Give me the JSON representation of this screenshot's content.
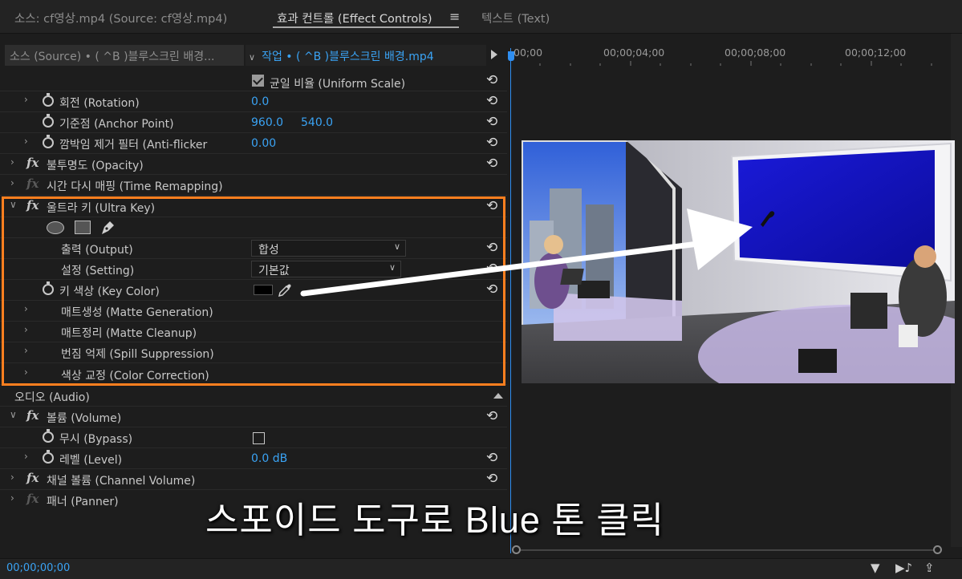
{
  "tabs": [
    {
      "label": "소스: cf영상.mp4 (Source: cf영상.mp4)"
    },
    {
      "label": "효과 컨트롤 (Effect Controls)"
    },
    {
      "label": "텍스트 (Text)"
    }
  ],
  "header": {
    "source_clip": "소스 (Source) • ( ^B )블루스크린 배경...",
    "sequence_clip": "작업 • ( ^B )블루스크린 배경.mp4",
    "ruler": [
      "00;00",
      "00;00;04;00",
      "00;00;08;00",
      "00;00;12;00"
    ]
  },
  "rows": {
    "uniform_scale": "균일 비율 (Uniform Scale)",
    "rotation": {
      "label": "회전 (Rotation)",
      "value": "0.0"
    },
    "anchor": {
      "label": "기준점 (Anchor Point)",
      "x": "960.0",
      "y": "540.0"
    },
    "antiflicker": {
      "label": "깜박임 제거 필터 (Anti-flicker",
      "value": "0.00"
    },
    "opacity": "불투명도 (Opacity)",
    "time_remap": "시간 다시 매핑 (Time Remapping)",
    "ultra_key": "울트라 키 (Ultra Key)",
    "output": {
      "label": "출력 (Output)",
      "value": "합성"
    },
    "setting": {
      "label": "설정 (Setting)",
      "value": "기본값"
    },
    "key_color": {
      "label": "키 색상 (Key Color)",
      "color": "#000000"
    },
    "matte_gen": "매트생성 (Matte Generation)",
    "matte_clean": "매트정리 (Matte Cleanup)",
    "spill": "번짐 억제 (Spill Suppression)",
    "color_corr": "색상 교정 (Color Correction)",
    "audio": "오디오 (Audio)",
    "volume": "볼륨 (Volume)",
    "bypass": "무시 (Bypass)",
    "level": {
      "label": "레벨 (Level)",
      "value": "0.0 dB"
    },
    "channel_volume": "채널 볼륨 (Channel Volume)",
    "panner": "패너 (Panner)"
  },
  "timecode": "00;00;00;00",
  "caption": "스포이드 도구로 Blue 톤 클릭",
  "colors": {
    "accent": "#3aa3f4",
    "highlight": "#ff7f1f",
    "panel_bg": "#1d1d1d"
  }
}
